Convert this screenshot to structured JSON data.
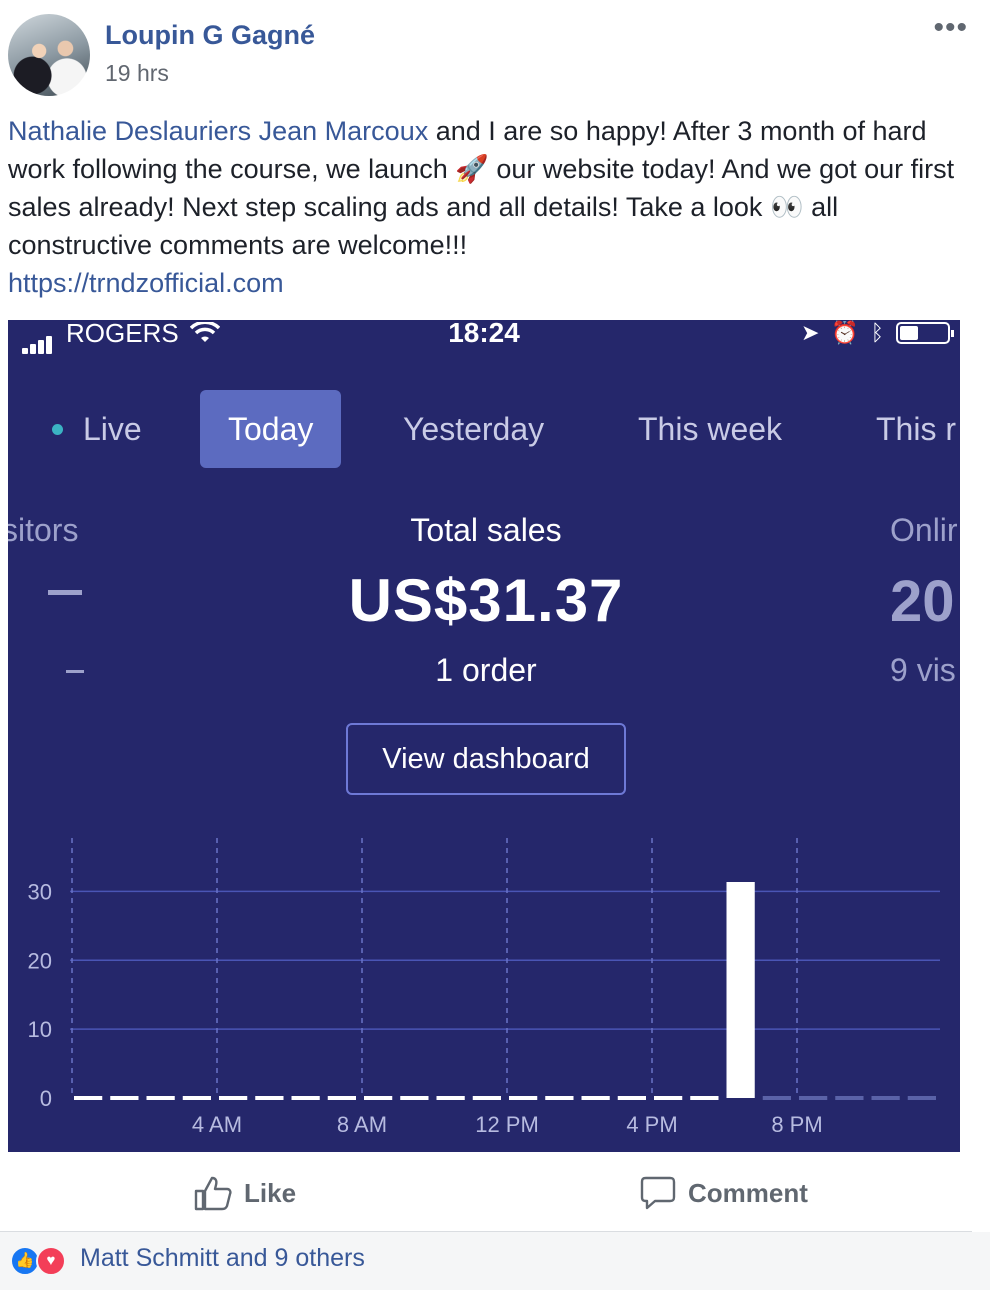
{
  "post": {
    "author": "Loupin G Gagné",
    "time": "19 hrs",
    "more_icon": "more-horizontal-icon",
    "mention_1": "Nathalie Deslauriers",
    "mention_2": "Jean Marcoux",
    "text_1": "and I are so happy! After 3 month of hard work following the course, we launch",
    "text_2": "our website today! And we got our first sales already! Next step scaling ads and all details! Take a look",
    "text_3": "all constructive comments are welcome!!!",
    "emoji_rocket": "🚀",
    "emoji_eyes": "👀",
    "link": "https://trndzofficial.com"
  },
  "screenshot": {
    "status_bar": {
      "carrier": "ROGERS",
      "time": "18:24"
    },
    "tabs": [
      {
        "label": "Live"
      },
      {
        "label": "Today"
      },
      {
        "label": "Yesterday"
      },
      {
        "label": "This week"
      },
      {
        "label": "This r"
      }
    ],
    "active_tab": "Today",
    "metric_left": {
      "label": "sitors"
    },
    "metric_center": {
      "label": "Total sales",
      "value": "US$31.37",
      "sub": "1 order"
    },
    "metric_right": {
      "label": "Onlir",
      "value": "20",
      "sub": "9 vis"
    },
    "view_dashboard": "View dashboard",
    "colors": {
      "background": "#25276b",
      "active_tab": "#5c6bc0",
      "bar": "#ffffff"
    }
  },
  "chart_data": {
    "type": "bar",
    "categories": [
      "12 AM",
      "1 AM",
      "2 AM",
      "3 AM",
      "4 AM",
      "5 AM",
      "6 AM",
      "7 AM",
      "8 AM",
      "9 AM",
      "10 AM",
      "11 AM",
      "12 PM",
      "1 PM",
      "2 PM",
      "3 PM",
      "4 PM",
      "5 PM",
      "6 PM",
      "7 PM",
      "8 PM",
      "9 PM",
      "10 PM",
      "11 PM"
    ],
    "values": [
      0,
      0,
      0,
      0,
      0,
      0,
      0,
      0,
      0,
      0,
      0,
      0,
      0,
      0,
      0,
      0,
      0,
      0,
      31.37,
      0,
      0,
      0,
      0,
      0
    ],
    "x_tick_labels": [
      "4 AM",
      "8 AM",
      "12 PM",
      "4 PM",
      "8 PM"
    ],
    "y_ticks": [
      0,
      10,
      20,
      30
    ],
    "ylim": [
      0,
      31.37
    ],
    "grid": true
  },
  "actions": {
    "like": "Like",
    "comment": "Comment"
  },
  "reactions": {
    "text": "Matt Schmitt and 9 others"
  }
}
